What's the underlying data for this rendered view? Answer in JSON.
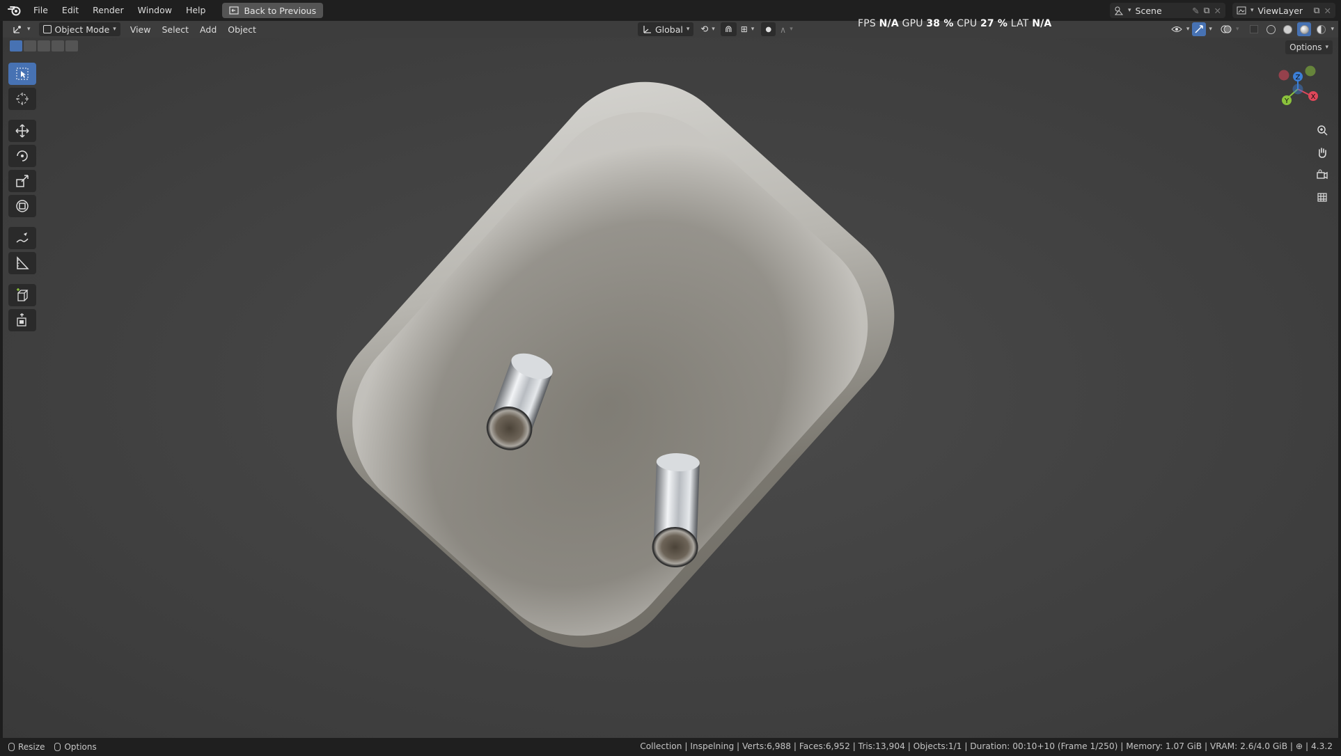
{
  "menubar": {
    "items": [
      "File",
      "Edit",
      "Render",
      "Window",
      "Help"
    ],
    "back_button": "Back to Previous",
    "scene_label": "Scene",
    "viewlayer_label": "ViewLayer"
  },
  "viewport_header": {
    "mode": "Object Mode",
    "menus": [
      "View",
      "Select",
      "Add",
      "Object"
    ],
    "transform_orientation": "Global",
    "options_label": "Options"
  },
  "stats": {
    "fps_label": "FPS",
    "fps_value": "N/A",
    "gpu_label": "GPU",
    "gpu_value": "38 %",
    "cpu_label": "CPU",
    "cpu_value": "27 %",
    "lat_label": "LAT",
    "lat_value": "N/A"
  },
  "gizmo": {
    "x": "X",
    "y": "Y",
    "z": "Z"
  },
  "statusbar": {
    "left_items": [
      "Resize",
      "Options"
    ],
    "info": "Collection | Inspelning | Verts:6,988 | Faces:6,952 | Tris:13,904 | Objects:1/1 | Duration: 00:10+10 (Frame 1/250) | Memory: 1.07 GiB | VRAM: 2.6/4.0 GiB |",
    "version": "4.3.2"
  },
  "colors": {
    "accent": "#4772b3",
    "axis_x": "#e0475a",
    "axis_y": "#8bc23c",
    "axis_z": "#3b7fd8"
  }
}
